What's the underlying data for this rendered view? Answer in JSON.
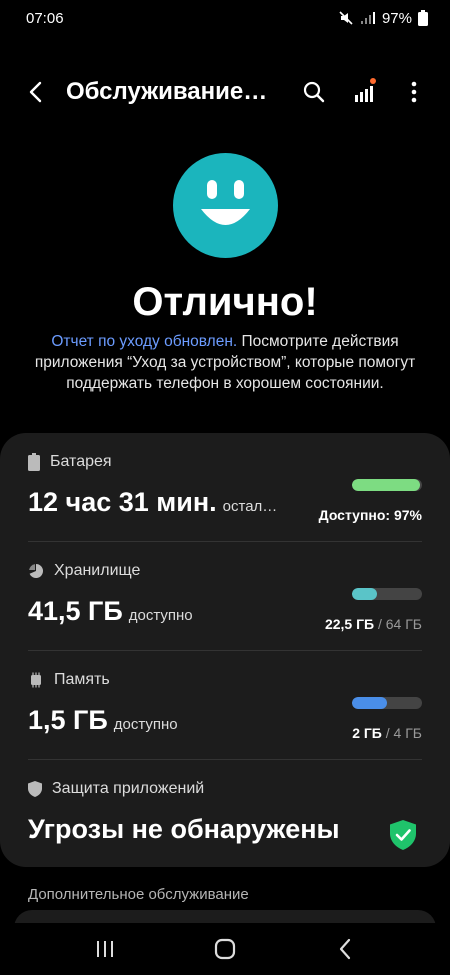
{
  "status": {
    "time": "07:06",
    "battery": "97%"
  },
  "appbar": {
    "title": "Обслуживание…"
  },
  "hero": {
    "headline": "Отлично!",
    "link": "Отчет по уходу обновлен.",
    "text": " Посмотрите действия приложения “Уход за устройством”, которые помогут поддержать телефон в хорошем состоянии."
  },
  "items": {
    "battery": {
      "label": "Батарея",
      "value": "12 час 31 мин.",
      "suffix": "остал…",
      "available": "Доступно: 97%",
      "level": 0.97,
      "color": "#7ddc82"
    },
    "storage": {
      "label": "Хранилище",
      "value": "41,5 ГБ",
      "suffix": "доступно",
      "used": "22,5 ГБ",
      "total": "/ 64 ГБ",
      "level": 0.35,
      "color": "#5ac4c8"
    },
    "memory": {
      "label": "Память",
      "value": "1,5 ГБ",
      "suffix": "доступно",
      "used": "2 ГБ",
      "total": "/ 4 ГБ",
      "level": 0.5,
      "color": "#4a8ee8"
    },
    "protection": {
      "label": "Защита приложений",
      "value": "Угрозы не обнаружены",
      "ok_color": "#1fc36b"
    }
  },
  "more": {
    "title": "Дополнительное обслуживание"
  }
}
